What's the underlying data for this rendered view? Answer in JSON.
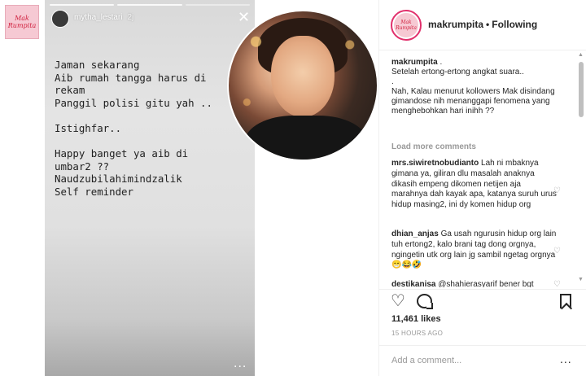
{
  "left_logo": {
    "line1": "Mak",
    "line2": "Rumpita"
  },
  "story": {
    "username": "mytha_lestari",
    "time_ago": "2j",
    "close_icon": "close-icon",
    "text": "Jaman sekarang\nAib rumah tangga harus di\nrekam\nPanggil polisi gitu yah ..\n\nIstighfar..\n\nHappy banget ya aib di\numbar2 ??\nNaudzubilahimindzalik\nSelf reminder",
    "more": "..."
  },
  "header": {
    "account_name": "makrumpita",
    "separator": "•",
    "follow_status": "Following",
    "avatar_text": {
      "line1": "Mak",
      "line2": "Rumpita"
    }
  },
  "caption": {
    "username": "makrumpita",
    "after_username": " .",
    "lines": [
      "Setelah ertong-ertong angkat suara..",
      ".",
      "Nah, Kalau menurut kollowers Mak disindang gimandose nih menanggapi fenomena yang menghebohkan hari inihh ??"
    ]
  },
  "load_more": "Load more comments",
  "comments": [
    {
      "username": "mrs.siwiretnobudianto",
      "text": "Lah ni mbaknya gimana ya, giliran dlu masalah anaknya dikasih empeng dikomen netijen aja marahnya dah kayak apa, katanya suruh urus hidup masing2, ini dy komen hidup org"
    },
    {
      "username": "dhian_anjas",
      "text": "Ga usah ngurusin hidup org lain tuh ertong2, kalo brani tag dong orgnya, ngingetin utk org lain jg sambil ngetag orgnya 😁😂🤣"
    },
    {
      "username": "destikanisa",
      "text": "@shahierasyarif bener bgt"
    }
  ],
  "likes": "11,461 likes",
  "timestamp": "15 HOURS AGO",
  "add_comment_placeholder": "Add a comment...",
  "more_options": "..."
}
